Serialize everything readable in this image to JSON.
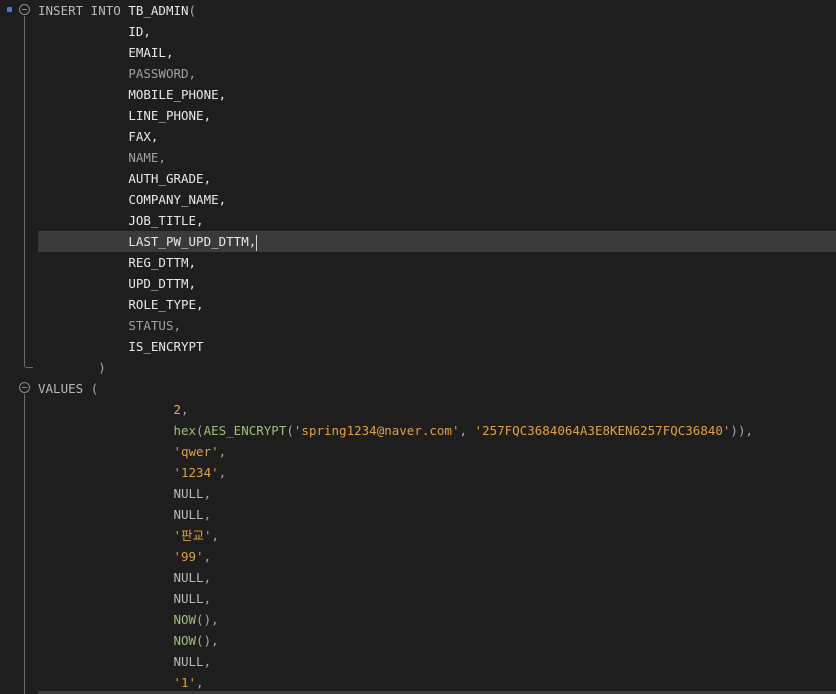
{
  "editor": {
    "insert_keyword": "INSERT INTO",
    "table_name": "TB_ADMIN",
    "open_paren": "(",
    "close_paren": ")",
    "values_keyword": "VALUES",
    "columns": [
      "ID,",
      "EMAIL,",
      "PASSWORD,",
      "MOBILE_PHONE,",
      "LINE_PHONE,",
      "FAX,",
      "NAME,",
      "AUTH_GRADE,",
      "COMPANY_NAME,",
      "JOB_TITLE,",
      "LAST_PW_UPD_DTTM,",
      "REG_DTTM,",
      "UPD_DTTM,",
      "ROLE_TYPE,",
      "STATUS,",
      "IS_ENCRYPT"
    ],
    "values": {
      "v1": "2",
      "v2_hex": "hex",
      "v2_aes": "AES_ENCRYPT",
      "v2_arg1": "'spring1234@naver.com'",
      "v2_arg2": "'257FQC3684064A3E8KEN6257FQC36840'",
      "v3": "'qwer'",
      "v4": "'1234'",
      "v5": "NULL",
      "v6": "NULL",
      "v7": "'판교'",
      "v8": "'99'",
      "v9": "NULL",
      "v10": "NULL",
      "v11": "NOW",
      "v12": "NOW",
      "v13": "NULL",
      "v14": "'1'"
    },
    "colors": {
      "background": "#1e1e1e",
      "current_line": "#3a3a3a",
      "string": "#e0a040",
      "function": "#9cbf78",
      "modified_marker": "#3f7fd6"
    }
  }
}
